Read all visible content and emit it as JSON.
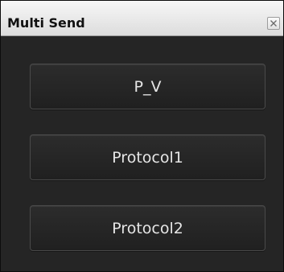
{
  "window": {
    "title": "Multi Send",
    "close_icon": "close-icon"
  },
  "buttons": [
    {
      "label": "P_V"
    },
    {
      "label": "Protocol1"
    },
    {
      "label": "Protocol2"
    }
  ],
  "colors": {
    "background": "#252525",
    "titlebar": "#e8e8e8",
    "button_text": "#e6e6e6",
    "button_border": "#4a4a4a"
  }
}
